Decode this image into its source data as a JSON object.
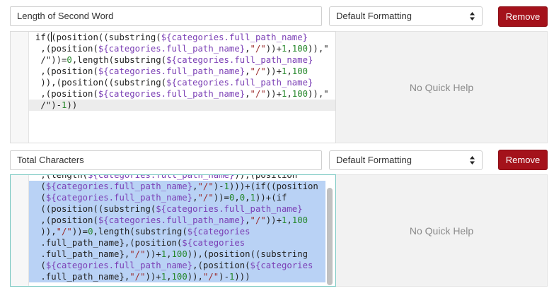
{
  "formula_rows": [
    {
      "name_value": "Length of Second Word",
      "format_selected": "Default Formatting",
      "remove_label": "Remove",
      "quick_help_text": "No Quick Help",
      "code_lines": [
        "if((position((substring(${categories.full_path_name}",
        " ,(position(${categories.full_path_name},\"/\"))+1,100)),\"",
        " /\"))=0,length(substring(${categories.full_path_name}",
        " ,(position(${categories.full_path_name},\"/\"))+1,100",
        " )),(position((substring(${categories.full_path_name}",
        " ,(position(${categories.full_path_name},\"/\"))+1,100)),\"",
        " /\")-1))"
      ]
    },
    {
      "name_value": "Total Characters",
      "format_selected": "Default Formatting",
      "remove_label": "Remove",
      "quick_help_text": "No Quick Help",
      "code_lines": [
        " ,(length(${categories.full_path_name})),(position",
        " (${categories.full_path_name},\"/\")-1)))+(if((position",
        " (${categories.full_path_name},\"/\"))=0,0,1))+(if",
        " ((position((substring(${categories.full_path_name}",
        " ,(position(${categories.full_path_name},\"/\"))+1,100",
        " )),\"/\"))=0,length(substring(${categories",
        " .full_path_name},(position(${categories",
        " .full_path_name},\"/\"))+1,100)),(position((substring",
        " (${categories.full_path_name},(position(${categories",
        " .full_path_name},\"/\"))+1,100)),\"/\")-1)))"
      ]
    }
  ]
}
